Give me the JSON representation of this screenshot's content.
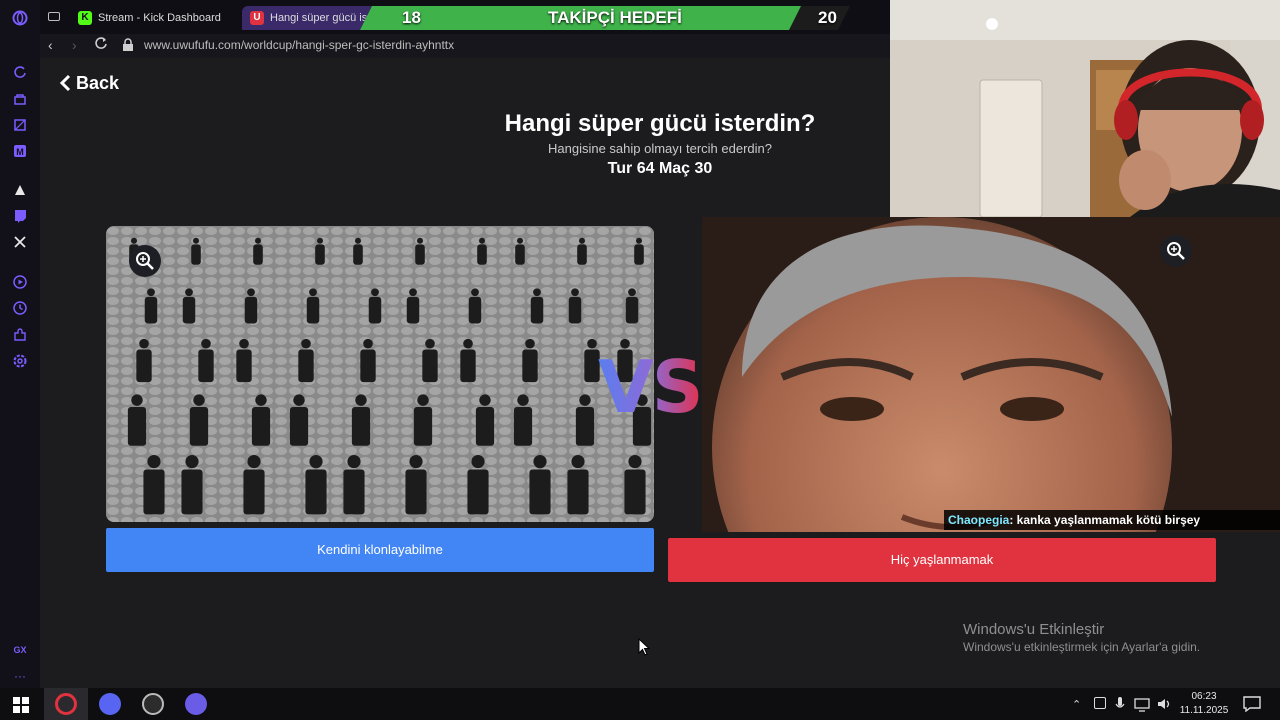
{
  "tabs": [
    {
      "label": "Stream - Kick Dashboard",
      "favicon": "K",
      "color": "#53fc18",
      "active": false
    },
    {
      "label": "Hangi süper gücü isterdin?",
      "favicon": "U",
      "color": "#e0323f",
      "active": true
    }
  ],
  "address": {
    "url": "www.uwufufu.com/worldcup/hangi-sper-gc-isterdin-ayhnttx"
  },
  "follower_goal": {
    "current": "18",
    "label": "TAKİPÇİ HEDEFİ",
    "target": "20",
    "progress": 0.9,
    "color": "#3fb34a"
  },
  "page": {
    "back_label": "Back",
    "title": "Hangi süper gücü isterdin?",
    "subtitle": "Hangisine sahip olmayı tercih ederdin?",
    "round": "Tur 64 Maç 30",
    "vs": "VS"
  },
  "choices": {
    "left": {
      "label": "Kendini klonlayabilme",
      "color": "#4285f4"
    },
    "right": {
      "label": "Hiç yaşlanmamak",
      "color": "#e0323f"
    }
  },
  "chat": {
    "user": "Chaopegia",
    "message": ": kanka yaşlanmamak kötü birşey"
  },
  "windows_activation": {
    "title": "Windows'u Etkinleştir",
    "subtitle": "Windows'u etkinleştirmek için Ayarlar'a gidin."
  },
  "clock": {
    "time": "06:23",
    "date": "11.11.2025"
  },
  "sidebar_icons": [
    "reload-icon",
    "vpn-icon",
    "shop-icon",
    "messenger-icon",
    "kick-icon",
    "twitch-icon",
    "x-icon",
    "player-icon",
    "history-icon",
    "extensions-icon",
    "settings-icon",
    "gx-icon",
    "more-icon"
  ],
  "sidebar_footer": {
    "gx": "GX",
    "more": "···"
  }
}
